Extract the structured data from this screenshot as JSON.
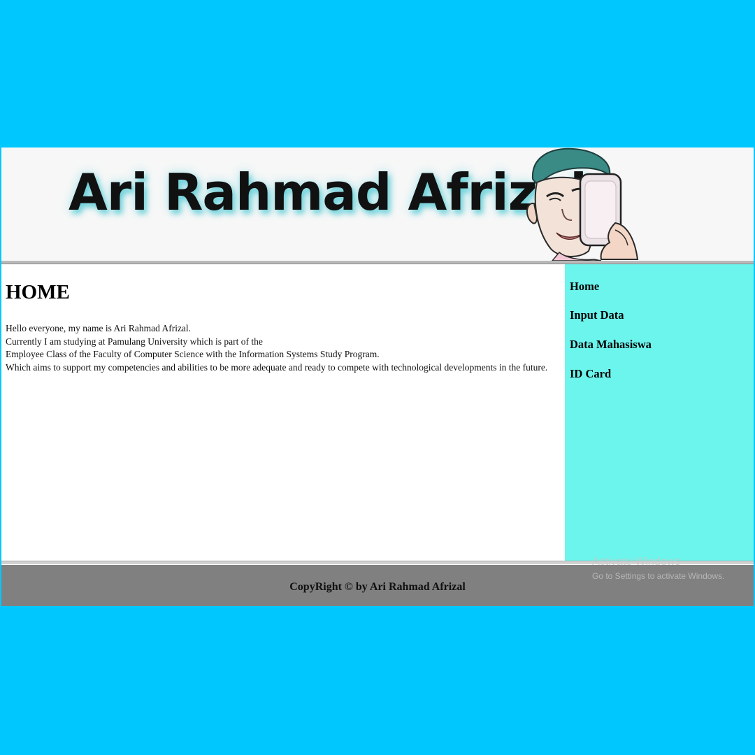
{
  "header": {
    "banner_title": "Ari Rahmad Afrizal"
  },
  "main": {
    "title": "HOME",
    "intro_lines": [
      "Hello everyone, my name is Ari Rahmad Afrizal.",
      "Currently I am studying at Pamulang University which is part of the",
      "Employee Class of the Faculty of Computer Science with the Information Systems Study Program.",
      "Which aims to support my competencies and abilities to be more adequate and ready to compete with technological developments in the future."
    ]
  },
  "sidebar": {
    "items": [
      {
        "label": "Home"
      },
      {
        "label": "Input Data"
      },
      {
        "label": "Data Mahasiswa"
      },
      {
        "label": "ID Card"
      }
    ]
  },
  "footer": {
    "copyright": "CopyRight © by Ari Rahmad Afrizal"
  },
  "watermark": {
    "title": "Activate Windows",
    "subtitle": "Go to Settings to activate Windows."
  },
  "colors": {
    "outer_background": "#00c8ff",
    "sidebar_background": "#6cf5ec",
    "footer_background": "#808080",
    "banner_background": "#f7f7f7"
  },
  "icons": {
    "banner_photo": "person-with-phone-illustration"
  }
}
